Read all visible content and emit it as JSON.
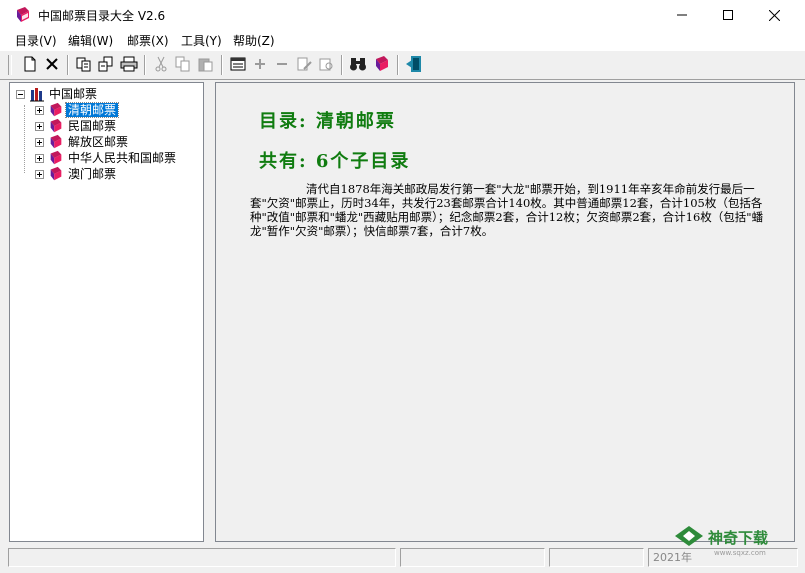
{
  "window": {
    "title": "中国邮票目录大全 V2.6",
    "controls": {
      "minimize": "minimize-icon",
      "maximize": "maximize-icon",
      "close": "close-icon"
    }
  },
  "menu": [
    {
      "label": "目录(V)"
    },
    {
      "label": "编辑(W)"
    },
    {
      "label": "邮票(X)"
    },
    {
      "label": "工具(Y)"
    },
    {
      "label": "帮助(Z)"
    }
  ],
  "toolbar": {
    "buttons": [
      {
        "icon": "new-document-icon"
      },
      {
        "icon": "delete-icon"
      },
      {
        "icon": "copy-record-icon"
      },
      {
        "icon": "paste-record-icon"
      },
      {
        "icon": "print-icon"
      },
      {
        "icon": "cut-icon"
      },
      {
        "icon": "copy-icon"
      },
      {
        "icon": "paste-icon"
      },
      {
        "icon": "catalog-icon"
      },
      {
        "icon": "add-icon"
      },
      {
        "icon": "remove-icon"
      },
      {
        "icon": "edit-icon"
      },
      {
        "icon": "properties-icon"
      },
      {
        "icon": "binoculars-search-icon"
      },
      {
        "icon": "book-icon"
      },
      {
        "icon": "exit-icon"
      }
    ]
  },
  "tree": {
    "root": {
      "label": "中国邮票",
      "icon": "books-icon"
    },
    "children": [
      {
        "label": "清朝邮票",
        "selected": true,
        "icon": "stamp-book-icon"
      },
      {
        "label": "民国邮票",
        "selected": false,
        "icon": "stamp-book-icon"
      },
      {
        "label": "解放区邮票",
        "selected": false,
        "icon": "stamp-book-icon"
      },
      {
        "label": "中华人民共和国邮票",
        "selected": false,
        "icon": "stamp-book-icon"
      },
      {
        "label": "澳门邮票",
        "selected": false,
        "icon": "stamp-book-icon"
      }
    ]
  },
  "content": {
    "catalog_heading": "目录: 清朝邮票",
    "count_heading": "共有: 6个子目录",
    "description": "清代自1878年海关邮政局发行第一套\"大龙\"邮票开始，到1911年辛亥年命前发行最后一套\"欠资\"邮票止，历时34年，共发行23套邮票合计140枚。其中普通邮票12套，合计105枚（包括各种\"改值\"邮票和\"蟠龙\"西藏贴用邮票）；纪念邮票2套，合计12枚；欠资邮票2套，合计16枚（包括\"蟠龙\"暂作\"欠资\"邮票）；快信邮票7套，合计7枚。",
    "heading_color": "#107c10"
  },
  "statusbar": {
    "panes": [
      "",
      "",
      "",
      "2021年"
    ]
  },
  "watermark": {
    "brand": "神奇下载",
    "url": "www.sqxz.com"
  },
  "colors": {
    "selection": "#0078d7",
    "heading": "#107c10"
  }
}
